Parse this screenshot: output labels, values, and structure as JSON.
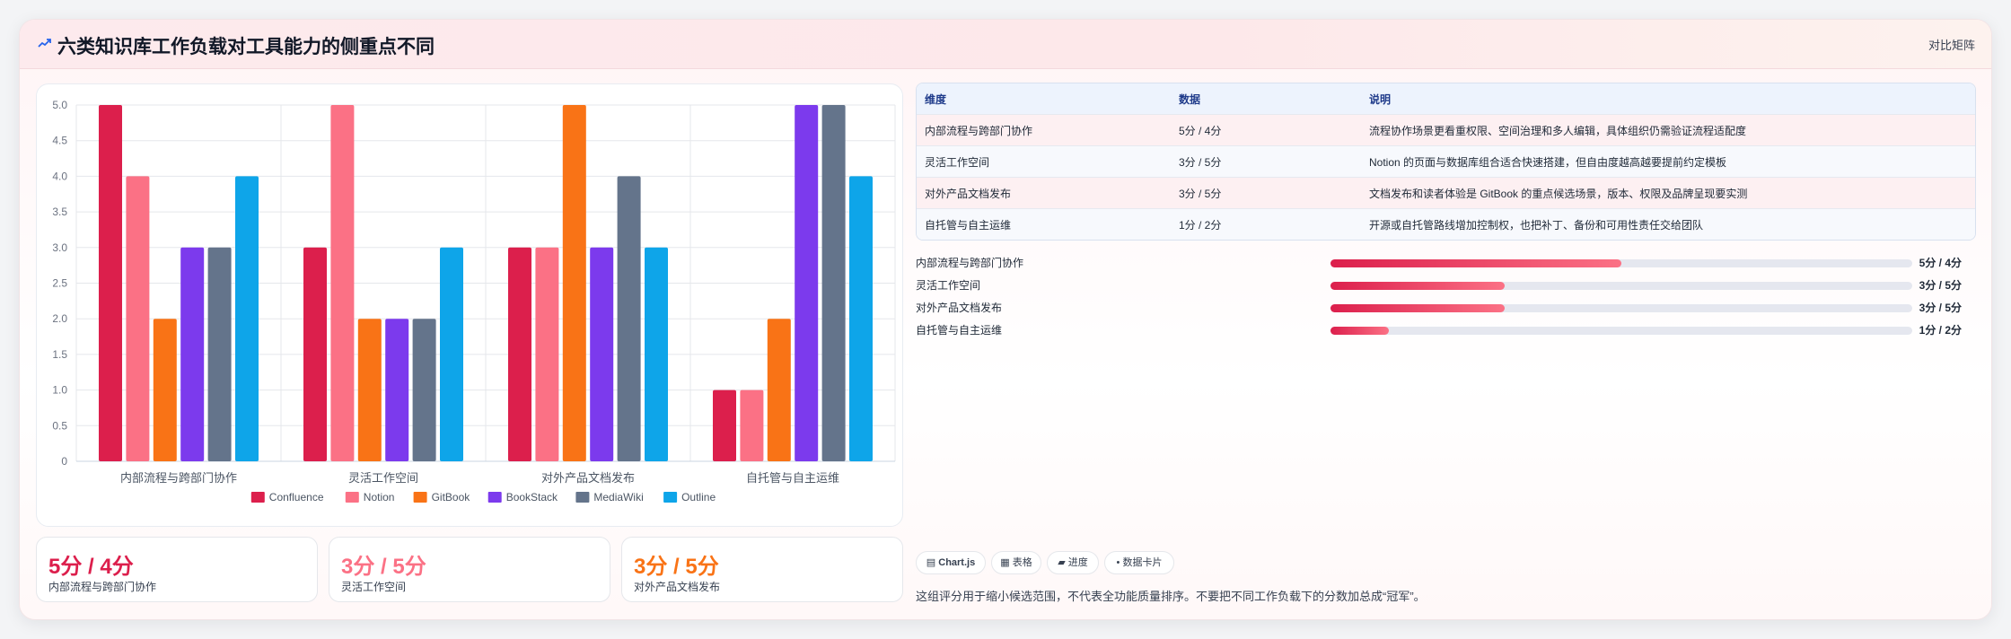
{
  "header": {
    "title_icon": "chart-line-icon",
    "title": "六类知识库工作负载对工具能力的侧重点不同",
    "action": "对比矩阵"
  },
  "chart_data": {
    "type": "bar",
    "categories": [
      "内部流程与跨部门协作",
      "灵活工作空间",
      "对外产品文档发布",
      "自托管与自主运维"
    ],
    "series": [
      {
        "name": "Confluence",
        "color": "#dc1f4c",
        "values": [
          5,
          3,
          3,
          1
        ]
      },
      {
        "name": "Notion",
        "color": "#fb7185",
        "values": [
          4,
          5,
          3,
          1
        ]
      },
      {
        "name": "GitBook",
        "color": "#f97316",
        "values": [
          2,
          2,
          5,
          2
        ]
      },
      {
        "name": "BookStack",
        "color": "#7c3aed",
        "values": [
          3,
          2,
          3,
          5
        ]
      },
      {
        "name": "MediaWiki",
        "color": "#64748b",
        "values": [
          3,
          2,
          4,
          5
        ]
      },
      {
        "name": "Outline",
        "color": "#0ea5e9",
        "values": [
          4,
          3,
          3,
          4
        ]
      }
    ],
    "ylim": [
      0,
      5
    ],
    "yticks": [
      "0",
      "0.5",
      "1.0",
      "1.5",
      "2.0",
      "2.5",
      "3.0",
      "3.5",
      "4.0",
      "4.5",
      "5.0"
    ],
    "grid": true,
    "legend_position": "bottom"
  },
  "table": {
    "headers": [
      "维度",
      "数据",
      "说明"
    ],
    "rows": [
      [
        "内部流程与跨部门协作",
        "5分 / 4分",
        "流程协作场景更看重权限、空间治理和多人编辑，具体组织仍需验证流程适配度"
      ],
      [
        "灵活工作空间",
        "3分 / 5分",
        "Notion 的页面与数据库组合适合快速搭建，但自由度越高越要提前约定模板"
      ],
      [
        "对外产品文档发布",
        "3分 / 5分",
        "文档发布和读者体验是 GitBook 的重点候选场景，版本、权限及品牌呈现要实测"
      ],
      [
        "自托管与自主运维",
        "1分 / 2分",
        "开源或自托管路线增加控制权，也把补丁、备份和可用性责任交给团队"
      ]
    ]
  },
  "progress": [
    {
      "label": "内部流程与跨部门协作",
      "value": "5分 / 4分",
      "fraction": 0.5
    },
    {
      "label": "灵活工作空间",
      "value": "3分 / 5分",
      "fraction": 0.3
    },
    {
      "label": "对外产品文档发布",
      "value": "3分 / 5分",
      "fraction": 0.3
    },
    {
      "label": "自托管与自主运维",
      "value": "1分 / 2分",
      "fraction": 0.1
    }
  ],
  "kpis": [
    {
      "value": "5分 / 4分",
      "label": "内部流程与跨部门协作",
      "color": "#dc1f4c"
    },
    {
      "value": "3分 / 5分",
      "label": "灵活工作空间",
      "color": "#fb7185"
    },
    {
      "value": "3分 / 5分",
      "label": "对外产品文档发布",
      "color": "#f97316"
    }
  ],
  "chips": [
    {
      "icon": "chart-icon",
      "glyph": "▤",
      "label": "Chart.js"
    },
    {
      "icon": "table-icon",
      "glyph": "▦",
      "label": "表格"
    },
    {
      "icon": "progress-icon",
      "glyph": "▰",
      "label": "进度"
    },
    {
      "icon": "dot-icon",
      "glyph": "•",
      "label": "数据卡片"
    }
  ],
  "note": "这组评分用于缩小候选范围，不代表全功能质量排序。不要把不同工作负载下的分数加总成“冠军”。"
}
